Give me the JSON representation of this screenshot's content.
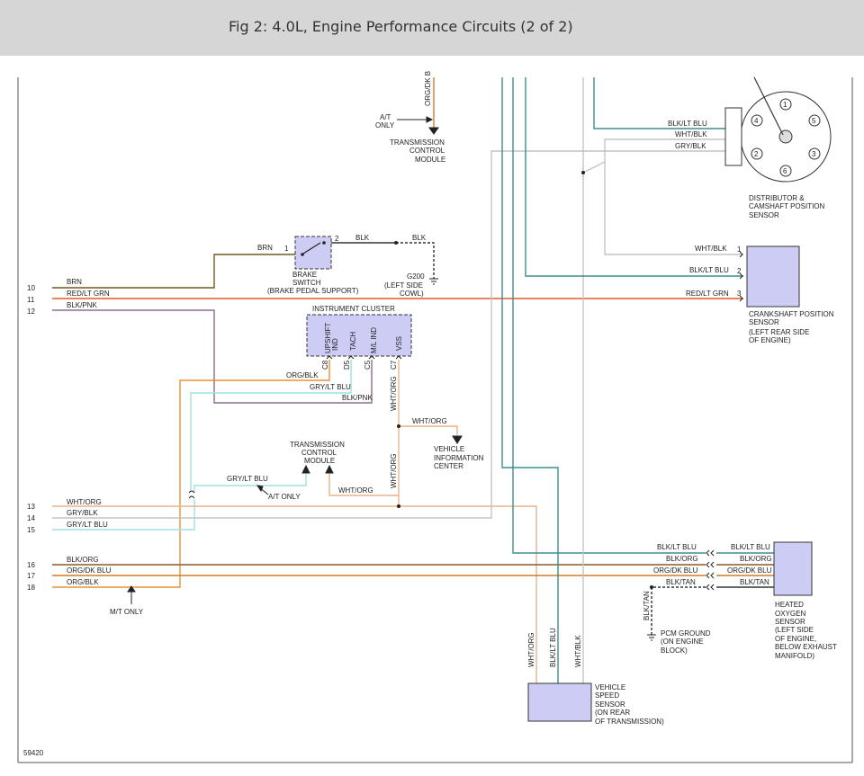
{
  "header": {
    "title": "Fig 2: 4.0L, Engine Performance Circuits (2 of 2)"
  },
  "figure_id": "59420",
  "colors": {
    "brn": "#6b5a1e",
    "red_lt_grn": "#e05a2c",
    "blk_pnk": "#8a6e8a",
    "org": "#e8913a",
    "wht_org": "#e8b488",
    "gry": "#c4c4c4",
    "lt_blu": "#9ee0e4",
    "blk_lt_blu": "#3b8f8f",
    "blk": "#333333",
    "component_fill": "#ccccf5"
  },
  "pins": [
    "10",
    "11",
    "12",
    "13",
    "14",
    "15",
    "16",
    "17",
    "18"
  ],
  "wires": {
    "p10": "BRN",
    "p11": "RED/LT GRN",
    "p12": "BLK/PNK",
    "p13": "WHT/ORG",
    "p14": "GRY/BLK",
    "p15": "GRY/LT BLU",
    "p16": "BLK/ORG",
    "p17": "ORG/DK BLU",
    "p18": "ORG/BLK",
    "brake_brn": "BRN",
    "brake_blk": "BLK",
    "brake_blk2": "BLK",
    "org_dk_b": "ORG/DK B",
    "dist_1": "BLK/LT BLU",
    "dist_2": "WHT/BLK",
    "dist_3": "GRY/BLK",
    "crank_1": "WHT/BLK",
    "crank_2": "BLK/LT BLU",
    "crank_3": "RED/LT GRN",
    "ic_org_blk": "ORG/BLK",
    "ic_gry_lt_blu": "GRY/LT BLU",
    "ic_blk_pnk": "BLK/PNK",
    "ic_wht_org": "WHT/ORG",
    "ic_wht_org_vert": "WHT/ORG",
    "vic_wht_org": "WHT/ORG",
    "wht_org_lower": "WHT/ORG",
    "tcm_gry_lt_blu": "GRY/LT BLU",
    "tcm_wht_org": "WHT/ORG",
    "o2_l1": "BLK/LT BLU",
    "o2_l2": "BLK/ORG",
    "o2_l3": "ORG/DK BLU",
    "o2_l4": "BLK/TAN",
    "o2_r1": "BLK/LT BLU",
    "o2_r2": "BLK/ORG",
    "o2_r3": "ORG/DK BLU",
    "o2_r4": "BLK/TAN",
    "pcm_gnd_wire": "BLK/TAN",
    "vss_1": "WHT/ORG",
    "vss_2": "BLK/LT BLU",
    "vss_3": "WHT/BLK"
  },
  "labels": {
    "at_only": "A/T",
    "at_only_2": "ONLY",
    "tcm_top": [
      "TRANSMISSION",
      "CONTROL",
      "MODULE"
    ],
    "dist_sensor": [
      "DISTRIBUTOR &",
      "CAMSHAFT POSITION",
      "SENSOR"
    ],
    "brake_switch": [
      "BRAKE",
      "SWITCH",
      "(BRAKE PEDAL SUPPORT)"
    ],
    "g200": [
      "G200",
      "(LEFT SIDE",
      "COWL)"
    ],
    "crank_sensor": [
      "CRANKSHAFT POSITION",
      "SENSOR",
      "(LEFT REAR SIDE",
      "OF ENGINE)"
    ],
    "instrument_cluster": "INSTRUMENT CLUSTER",
    "ic_pins": [
      "UPSHIFT",
      "IND",
      "TACH",
      "M/L IND",
      "VSS"
    ],
    "ic_cavities": [
      "C8",
      "D5",
      "C5",
      "C7"
    ],
    "vic": [
      "VEHICLE",
      "INFORMATION",
      "CENTER"
    ],
    "tcm_mid": [
      "TRANSMISSION",
      "CONTROL",
      "MODULE"
    ],
    "at_only_mid": "A/T ONLY",
    "mt_only": "M/T ONLY",
    "o2_sensor": [
      "HEATED",
      "OXYGEN",
      "SENSOR",
      "(LEFT SIDE",
      "OF ENGINE,",
      "BELOW EXHAUST",
      "MANIFOLD)"
    ],
    "pcm_ground": [
      "PCM GROUND",
      "(ON ENGINE",
      "BLOCK)"
    ],
    "vss_sensor": [
      "VEHICLE",
      "SPEED",
      "SENSOR",
      "(ON REAR",
      "OF TRANSMISSION)"
    ],
    "brake_pins": [
      "1",
      "2"
    ],
    "crank_pins": [
      "1",
      "2",
      "3"
    ],
    "dist_terms": [
      "1",
      "2",
      "3",
      "4",
      "5",
      "6"
    ]
  }
}
